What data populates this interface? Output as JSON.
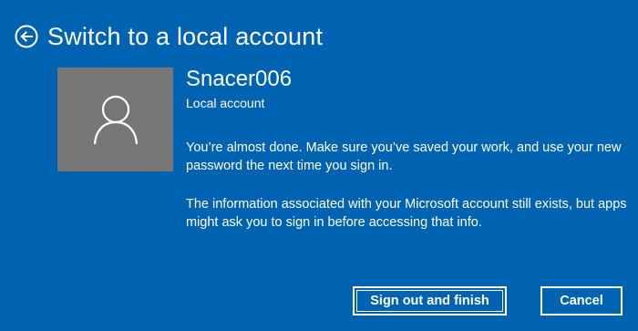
{
  "header": {
    "title": "Switch to a local account",
    "back_icon": "back-arrow-circle-icon"
  },
  "account": {
    "avatar_icon": "person-icon",
    "username": "Snacer006",
    "type": "Local account"
  },
  "messages": {
    "para1": "You’re almost done. Make sure you’ve saved your work, and use your new password the next time you sign in.",
    "para2": "The information associated with your Microsoft account still exists, but apps might ask you to sign in before accessing that info."
  },
  "buttons": {
    "primary": "Sign out and finish",
    "cancel": "Cancel"
  },
  "colors": {
    "background": "#0063b1",
    "avatar_bg": "#767676",
    "text": "#ffffff"
  }
}
